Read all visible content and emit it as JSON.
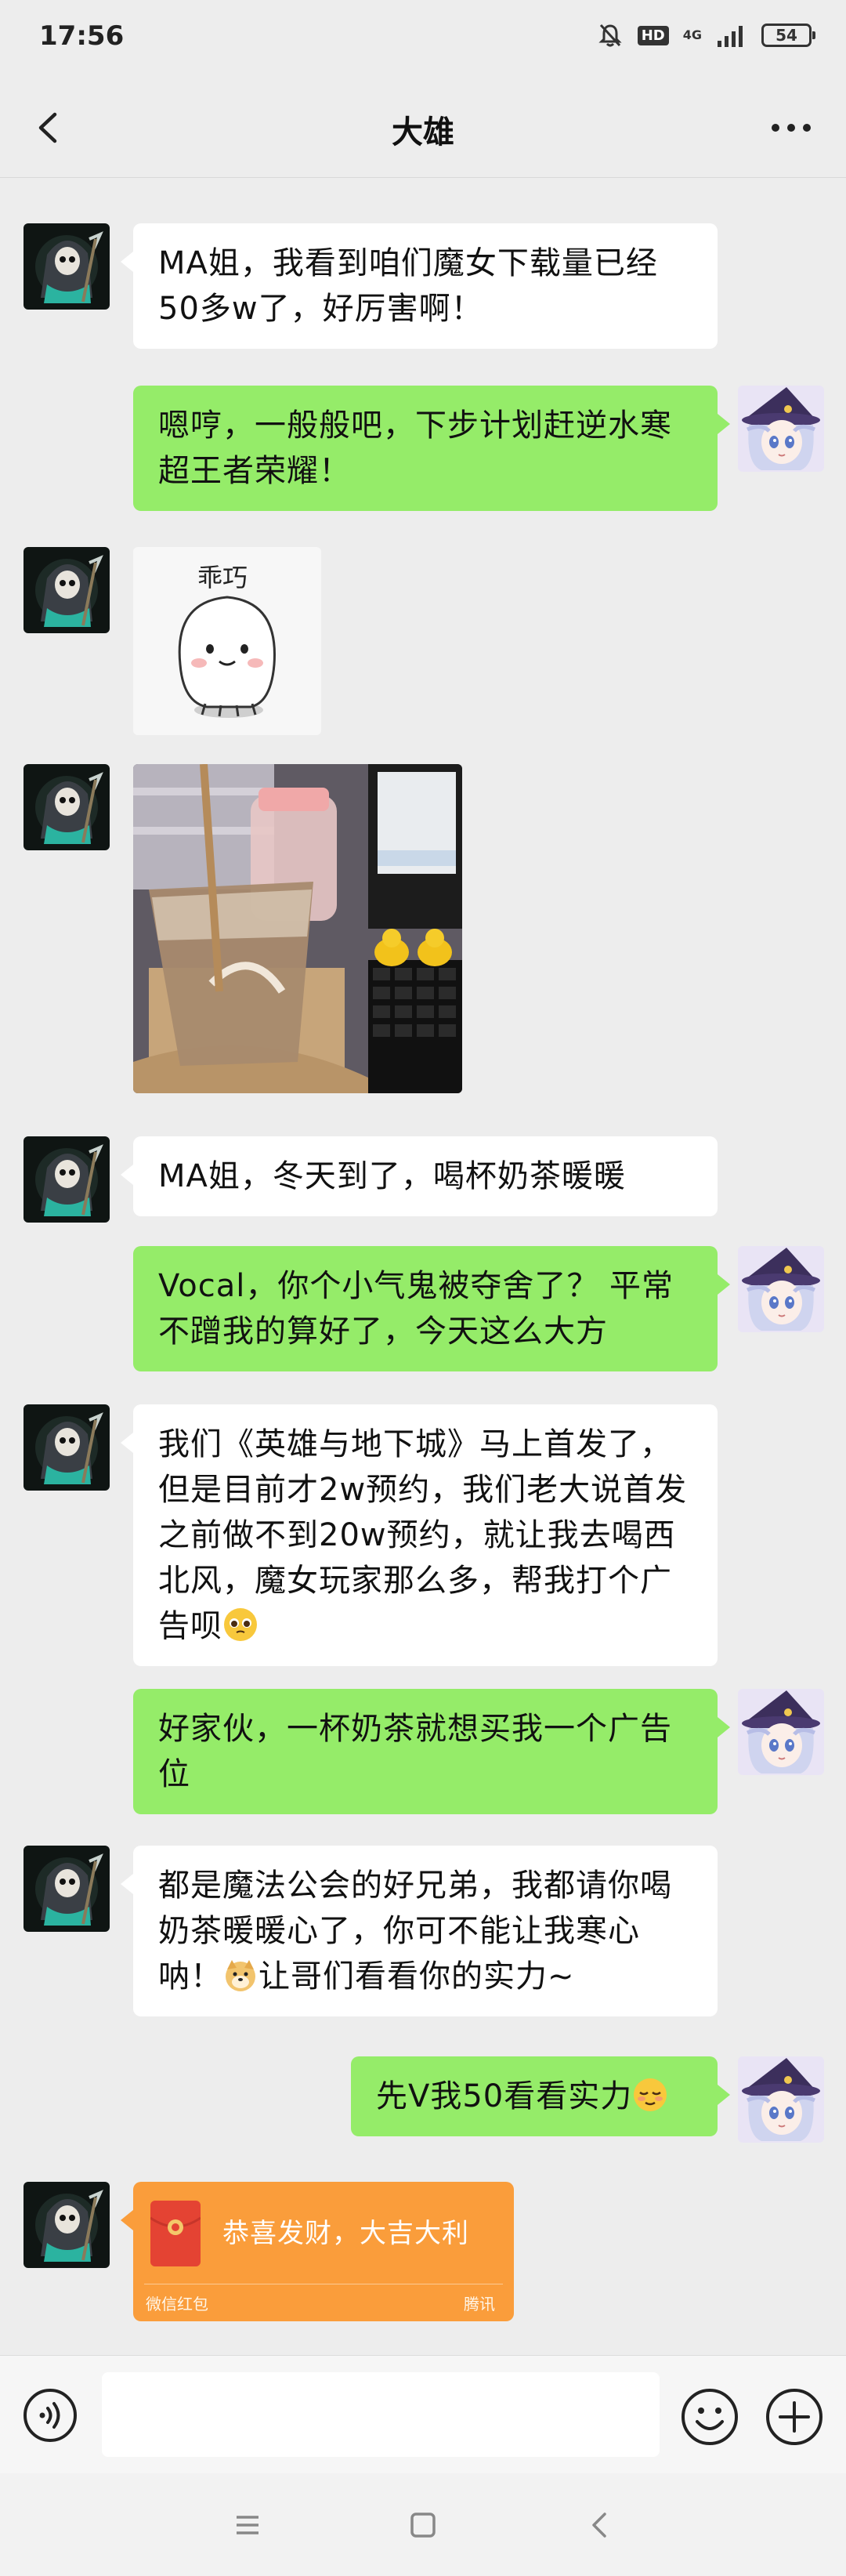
{
  "status_bar": {
    "time": "17:56",
    "hd_badge": "HD",
    "network": "4G",
    "battery": "54"
  },
  "header": {
    "title": "大雄",
    "back_icon": "chevron-left-icon",
    "more_icon": "more-dots-icon"
  },
  "messages": [
    {
      "side": "left",
      "type": "text",
      "text": "MA姐，我看到咱们魔女下载量已经50多w了，好厉害啊！"
    },
    {
      "side": "right",
      "type": "text",
      "text": "嗯哼，一般般吧，下步计划赶逆水寒超王者荣耀！"
    },
    {
      "side": "left",
      "type": "sticker",
      "label": "乖巧"
    },
    {
      "side": "left",
      "type": "image",
      "description_icon": "milk-tea-photo"
    },
    {
      "side": "left",
      "type": "text",
      "text": "MA姐，冬天到了，喝杯奶茶暖暖"
    },
    {
      "side": "right",
      "type": "text",
      "text": "Vocal，你个小气鬼被夺舍了？ 平常不蹭我的算好了，今天这么大方"
    },
    {
      "side": "left",
      "type": "text",
      "text": "我们《英雄与地下城》马上首发了，但是目前才2w预约，我们老大说首发之前做不到20w预约，就让我去喝西北风，魔女玩家那么多，帮我打个广告呗"
    },
    {
      "side": "right",
      "type": "text",
      "text": "好家伙，一杯奶茶就想买我一个广告位"
    },
    {
      "side": "left",
      "type": "text",
      "text_a": "都是魔法公会的好兄弟，我都请你喝奶茶暖暖心了，你可不能让我寒心呐！",
      "text_b": "让哥们看看你的实力~"
    },
    {
      "side": "right",
      "type": "text",
      "text": "先V我50看看实力"
    },
    {
      "side": "left",
      "type": "red_packet",
      "text": "恭喜发财，大吉大利",
      "label": "微信红包",
      "brand": "腾讯"
    }
  ],
  "input_bar": {
    "placeholder": "",
    "voice_icon": "voice-icon",
    "emoji_icon": "smiley-icon",
    "plus_icon": "plus-icon"
  },
  "nav_bar": {
    "menu_icon": "menu-icon",
    "home_icon": "home-icon",
    "back_icon": "back-icon"
  },
  "colors": {
    "background": "#ededed",
    "bubble_self": "#95ec69",
    "bubble_other": "#ffffff",
    "red_packet": "#fa9d3b"
  }
}
